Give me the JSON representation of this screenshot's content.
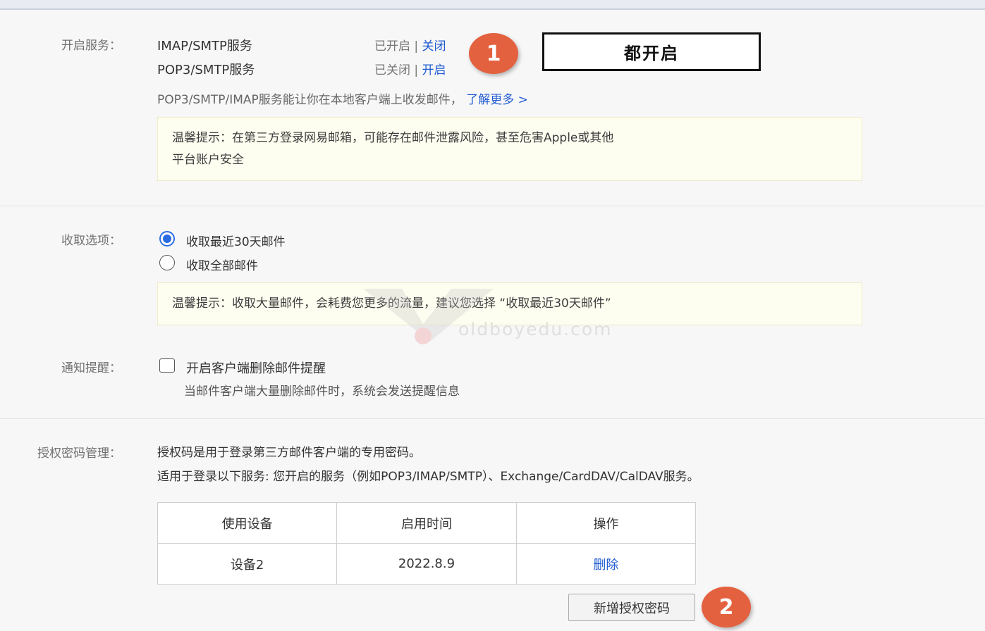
{
  "service": {
    "label": "开启服务：",
    "rows": [
      {
        "name": "IMAP/SMTP服务",
        "status": "已开启",
        "action": "关闭"
      },
      {
        "name": "POP3/SMTP服务",
        "status": "已关闭",
        "action": "开启"
      }
    ],
    "separator": "|",
    "desc": "POP3/SMTP/IMAP服务能让你在本地客户端上收发邮件，",
    "learn_more": "了解更多 >",
    "tip_line1": "温馨提示：在第三方登录网易邮箱，可能存在邮件泄露风险，甚至危害Apple或其他",
    "tip_line2": "平台账户安全",
    "callout": "都开启",
    "badge1": "1"
  },
  "fetch": {
    "label": "收取选项：",
    "option1": "收取最近30天邮件",
    "option2": "收取全部邮件",
    "selected": "option1",
    "tip": "温馨提示：收取大量邮件，会耗费您更多的流量，建议您选择 “收取最近30天邮件”"
  },
  "notify": {
    "label": "通知提醒：",
    "checkbox_label": "开启客户端删除邮件提醒",
    "checked": false,
    "desc": "当邮件客户端大量删除邮件时，系统会发送提醒信息"
  },
  "auth": {
    "label": "授权密码管理：",
    "line1": "授权码是用于登录第三方邮件客户端的专用密码。",
    "line2": "适用于登录以下服务: 您开启的服务（例如POP3/IMAP/SMTP）、Exchange/CardDAV/CalDAV服务。",
    "table": {
      "headers": [
        "使用设备",
        "启用时间",
        "操作"
      ],
      "rows": [
        {
          "device": "设备2",
          "time": "2022.8.9",
          "action": "删除"
        }
      ]
    },
    "new_button": "新增授权密码",
    "badge2": "2"
  },
  "watermark": {
    "text": "oldboyedu.com"
  },
  "colors": {
    "link": "#1f5bd1",
    "badge": "#e4613f",
    "tip_bg": "#fdfdf0",
    "radio": "#2b6de1"
  }
}
